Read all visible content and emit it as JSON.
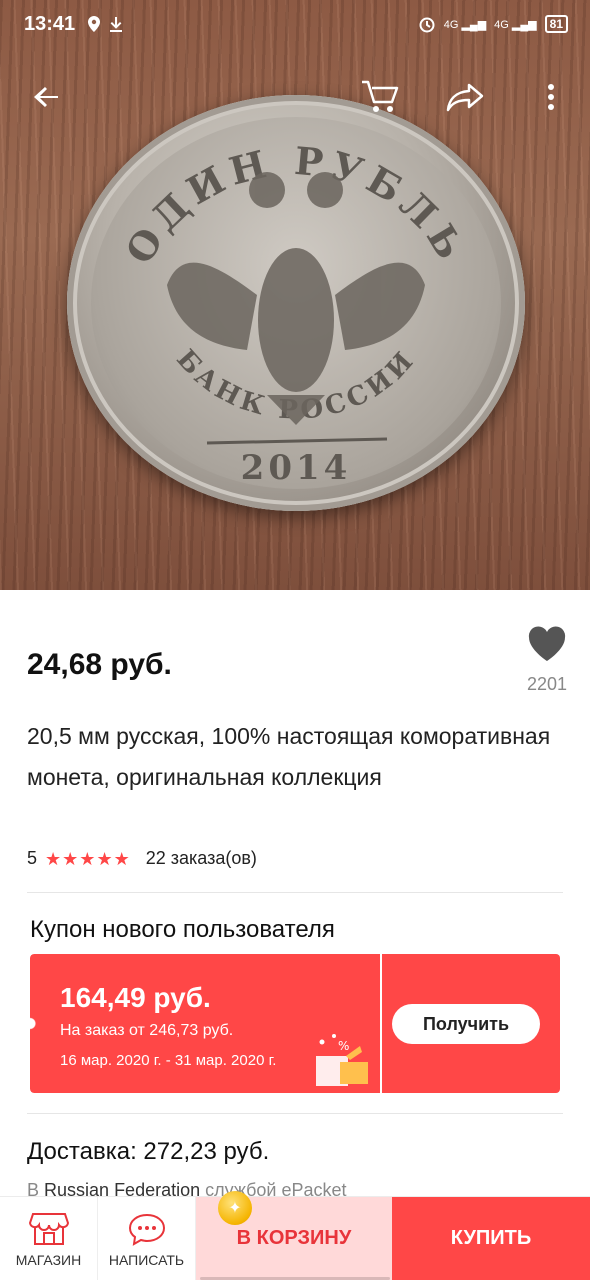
{
  "status_bar": {
    "time": "13:41",
    "icons": [
      "location-icon",
      "download-icon",
      "alarm-icon",
      "signal-4g-icon",
      "signal-4g-icon"
    ],
    "net1": "4G",
    "net2": "4G",
    "battery": "81"
  },
  "toolbar": {
    "back_icon": "arrow-left-icon",
    "cart_icon": "cart-icon",
    "share_icon": "share-icon",
    "more_icon": "more-vertical-icon"
  },
  "hero": {
    "coin_top_text": "ОДИН РУБЛЬ",
    "coin_bottom_text": "БАНК РОССИИ",
    "coin_year": "2014"
  },
  "product": {
    "price": "24,68 руб.",
    "wishlist_count": "2201",
    "title": "20,5 мм русская, 100% настоящая коморативная монета, оригинальная коллекция",
    "rating": "5",
    "orders": "22 заказа(ов)"
  },
  "coupon": {
    "section_title": "Купон нового пользователя",
    "amount": "164,49 руб.",
    "min_order": "На заказ от 246,73 руб.",
    "dates": "16 мар. 2020 г. - 31 мар. 2020 г.",
    "button": "Получить"
  },
  "shipping": {
    "label": "Доставка: 272,23 руб.",
    "prefix": "В",
    "country": "Russian Federation",
    "service": "службой ePacket"
  },
  "bottom_bar": {
    "store": "МАГАЗИН",
    "message": "НАПИСАТЬ",
    "add_to_cart": "В КОРЗИНУ",
    "buy": "КУПИТЬ"
  },
  "colors": {
    "accent": "#ff4747",
    "cart_bg": "#ffd9d9",
    "star": "#ff4747"
  }
}
